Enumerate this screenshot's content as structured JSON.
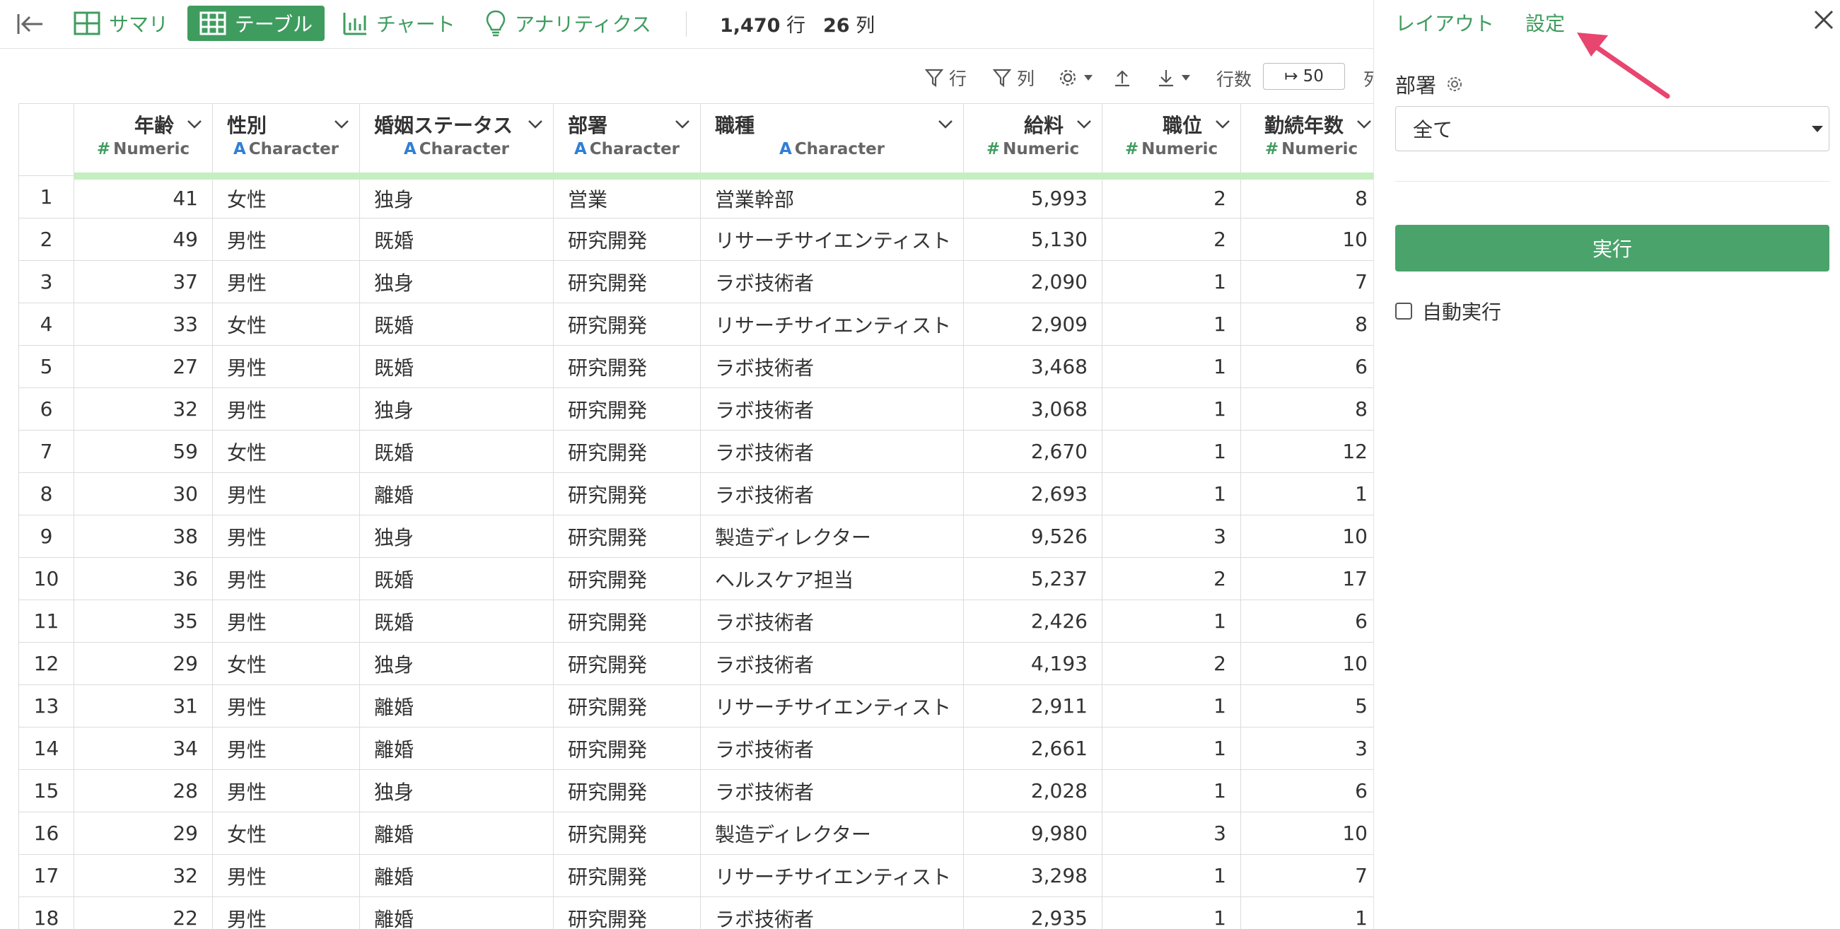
{
  "toolbar": {
    "tabs": {
      "summary": "サマリ",
      "table": "テーブル",
      "chart": "チャート",
      "analytics": "アナリティクス"
    },
    "rows_count": "1,470",
    "rows_unit": "行",
    "cols_count": "26",
    "cols_unit": "列"
  },
  "subtoolbar": {
    "row_filter": "行",
    "col_filter": "列",
    "row_limit_label": "行数",
    "row_limit_value": "↦ 50",
    "col_cut": "列"
  },
  "table": {
    "columns": [
      {
        "name": "年齢",
        "type": "Numeric"
      },
      {
        "name": "性別",
        "type": "Character"
      },
      {
        "name": "婚姻ステータス",
        "type": "Character"
      },
      {
        "name": "部署",
        "type": "Character"
      },
      {
        "name": "職種",
        "type": "Character"
      },
      {
        "name": "給料",
        "type": "Numeric"
      },
      {
        "name": "職位",
        "type": "Numeric"
      },
      {
        "name": "勤続年数",
        "type": "Numeric"
      }
    ],
    "rows": [
      [
        "1",
        "41",
        "女性",
        "独身",
        "営業",
        "営業幹部",
        "5,993",
        "2",
        "8"
      ],
      [
        "2",
        "49",
        "男性",
        "既婚",
        "研究開発",
        "リサーチサイエンティスト",
        "5,130",
        "2",
        "10"
      ],
      [
        "3",
        "37",
        "男性",
        "独身",
        "研究開発",
        "ラボ技術者",
        "2,090",
        "1",
        "7"
      ],
      [
        "4",
        "33",
        "女性",
        "既婚",
        "研究開発",
        "リサーチサイエンティスト",
        "2,909",
        "1",
        "8"
      ],
      [
        "5",
        "27",
        "男性",
        "既婚",
        "研究開発",
        "ラボ技術者",
        "3,468",
        "1",
        "6"
      ],
      [
        "6",
        "32",
        "男性",
        "独身",
        "研究開発",
        "ラボ技術者",
        "3,068",
        "1",
        "8"
      ],
      [
        "7",
        "59",
        "女性",
        "既婚",
        "研究開発",
        "ラボ技術者",
        "2,670",
        "1",
        "12"
      ],
      [
        "8",
        "30",
        "男性",
        "離婚",
        "研究開発",
        "ラボ技術者",
        "2,693",
        "1",
        "1"
      ],
      [
        "9",
        "38",
        "男性",
        "独身",
        "研究開発",
        "製造ディレクター",
        "9,526",
        "3",
        "10"
      ],
      [
        "10",
        "36",
        "男性",
        "既婚",
        "研究開発",
        "ヘルスケア担当",
        "5,237",
        "2",
        "17"
      ],
      [
        "11",
        "35",
        "男性",
        "既婚",
        "研究開発",
        "ラボ技術者",
        "2,426",
        "1",
        "6"
      ],
      [
        "12",
        "29",
        "女性",
        "独身",
        "研究開発",
        "ラボ技術者",
        "4,193",
        "2",
        "10"
      ],
      [
        "13",
        "31",
        "男性",
        "離婚",
        "研究開発",
        "リサーチサイエンティスト",
        "2,911",
        "1",
        "5"
      ],
      [
        "14",
        "34",
        "男性",
        "離婚",
        "研究開発",
        "ラボ技術者",
        "2,661",
        "1",
        "3"
      ],
      [
        "15",
        "28",
        "男性",
        "独身",
        "研究開発",
        "ラボ技術者",
        "2,028",
        "1",
        "6"
      ],
      [
        "16",
        "29",
        "女性",
        "離婚",
        "研究開発",
        "製造ディレクター",
        "9,980",
        "3",
        "10"
      ],
      [
        "17",
        "32",
        "男性",
        "離婚",
        "研究開発",
        "リサーチサイエンティスト",
        "3,298",
        "1",
        "7"
      ],
      [
        "18",
        "22",
        "男性",
        "離婚",
        "研究開発",
        "ラボ技術者",
        "2,935",
        "1",
        "1"
      ]
    ]
  },
  "panel": {
    "tab_layout": "レイアウト",
    "tab_settings": "設定",
    "dept_label": "部署",
    "dept_value": "全て",
    "run_label": "実行",
    "auto_run_label": "自動実行"
  },
  "colors": {
    "accent": "#3f9c5f",
    "run_button": "#4aa36b",
    "header_highlight": "#c5efc0",
    "annotation_arrow": "#e8456f"
  }
}
